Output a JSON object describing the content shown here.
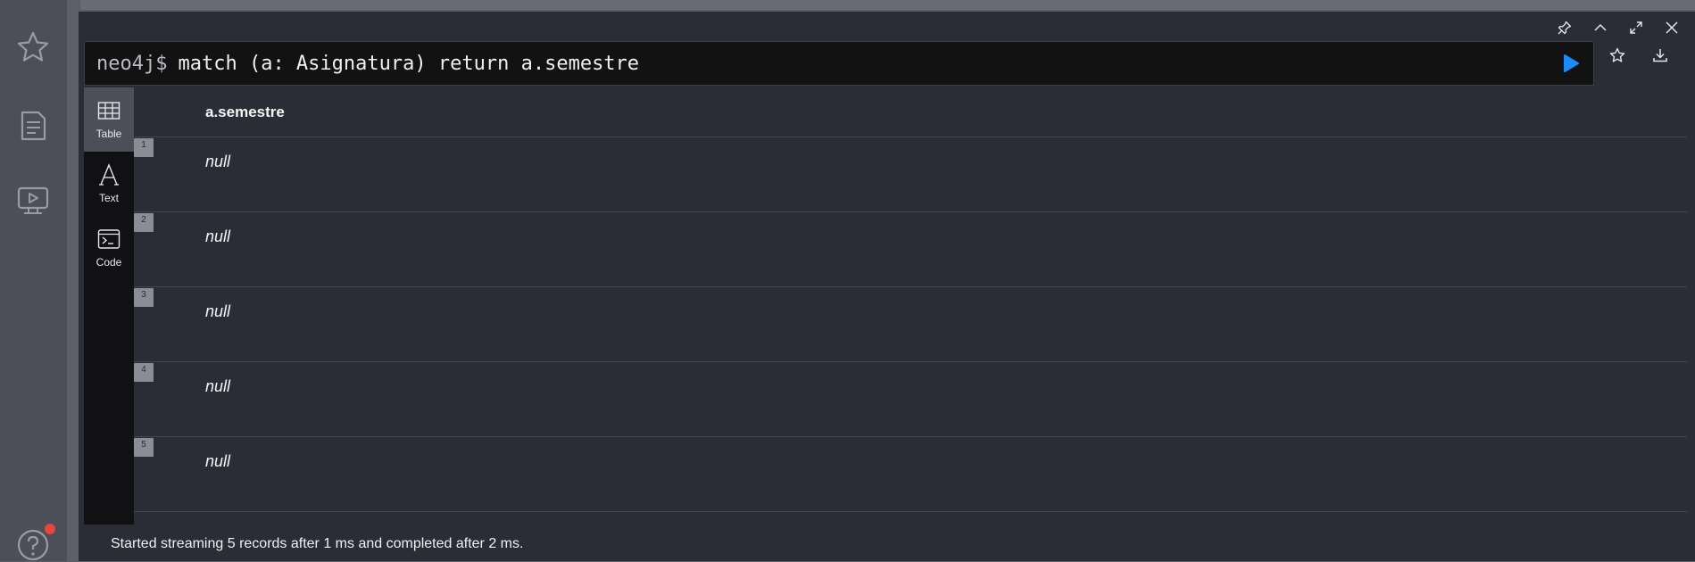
{
  "sidebar": {
    "items": [
      {
        "icon": "star-icon"
      },
      {
        "icon": "document-icon"
      },
      {
        "icon": "monitor-play-icon"
      },
      {
        "icon": "help-icon"
      }
    ],
    "notification_color": "#e8453c"
  },
  "frame": {
    "controls": [
      "pin-icon",
      "chevron-up-icon",
      "expand-icon",
      "close-icon"
    ]
  },
  "editor": {
    "prompt": "neo4j$",
    "query": "match (a: Asignatura) return a.semestre",
    "run_color": "#1a8cff"
  },
  "views": [
    {
      "label": "Table",
      "icon": "table-icon",
      "active": true
    },
    {
      "label": "Text",
      "icon": "text-icon",
      "active": false
    },
    {
      "label": "Code",
      "icon": "code-icon",
      "active": false
    }
  ],
  "table": {
    "column": "a.semestre",
    "rows": [
      {
        "index": "1",
        "value": "null"
      },
      {
        "index": "2",
        "value": "null"
      },
      {
        "index": "3",
        "value": "null"
      },
      {
        "index": "4",
        "value": "null"
      },
      {
        "index": "5",
        "value": "null"
      }
    ]
  },
  "status": "Started streaming 5 records after 1 ms and completed after 2 ms."
}
